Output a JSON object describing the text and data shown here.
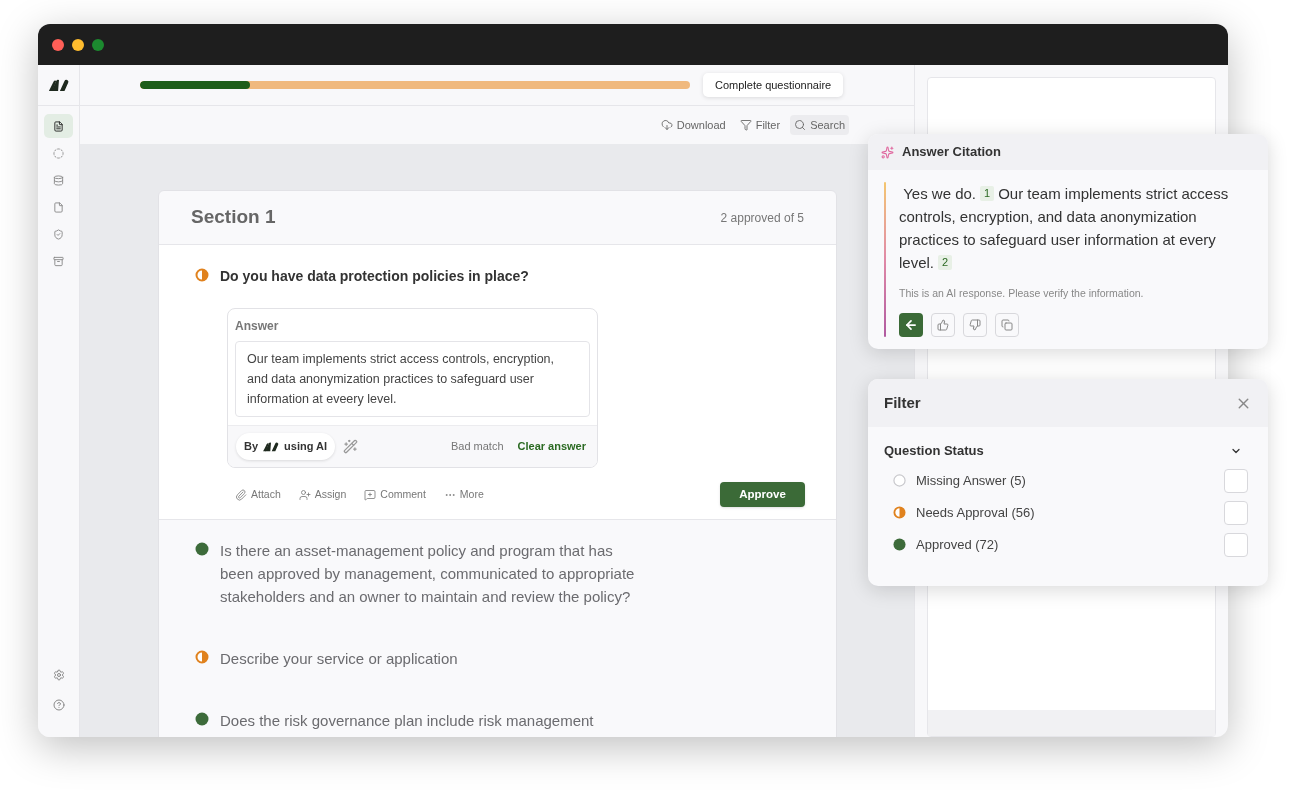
{
  "sidebar": {
    "items": [
      {
        "selected": true
      },
      {
        "selected": false
      },
      {
        "selected": false
      },
      {
        "selected": false
      },
      {
        "selected": false
      },
      {
        "selected": false
      }
    ]
  },
  "progress": {
    "level": 0.2
  },
  "complete_button": "Complete questionnaire",
  "toolbar": [
    "Download",
    "Filter",
    "Search"
  ],
  "section": {
    "title": "Section 1",
    "count": "2 approved of 5",
    "questions": [
      {
        "kind": "needs_approval",
        "expanded": true,
        "text": "Do you have data protection policies in place?",
        "answer": {
          "label": "Answer",
          "value": "Our team implements strict access controls, encryption, and data anonymization practices to safeguard user information at eveery level.",
          "by": "By",
          "by_suffix": "using AI",
          "bad_match": "Bad match",
          "clear": "Clear answer"
        },
        "actions": [
          "Attach",
          "Assign",
          "Comment",
          "More"
        ],
        "approve": "Approve"
      },
      {
        "kind": "approved",
        "expanded": false,
        "text": "Is there an asset-management policy and program that has been approved by management, communicated to appropriate stakeholders and an owner to maintain and review the policy?"
      },
      {
        "kind": "needs_approval",
        "expanded": false,
        "text": "Describe your service or application"
      },
      {
        "kind": "approved",
        "expanded": false,
        "text": "Does the risk governance plan include risk management"
      }
    ]
  },
  "citation": {
    "title": "Answer Citation",
    "parts": [
      {
        "kind": "text",
        "text": "Yes we do."
      },
      {
        "kind": "ref",
        "text": "1"
      },
      {
        "kind": "text",
        "text": "Our team implements strict access controls, encryption, and data anonymization practices to safeguard user information at every level."
      },
      {
        "kind": "ref",
        "text": "2"
      }
    ],
    "note": "This is an AI response. Please verify the information."
  },
  "filter": {
    "title": "Filter",
    "group": "Question Status",
    "expanded": true,
    "options": [
      {
        "kind": "missing",
        "label": "Missing Answer (5)",
        "checked": false
      },
      {
        "kind": "needs_approval",
        "label": "Needs Approval (56)",
        "checked": false
      },
      {
        "kind": "approved",
        "label": "Approved (72)",
        "checked": false
      }
    ]
  }
}
